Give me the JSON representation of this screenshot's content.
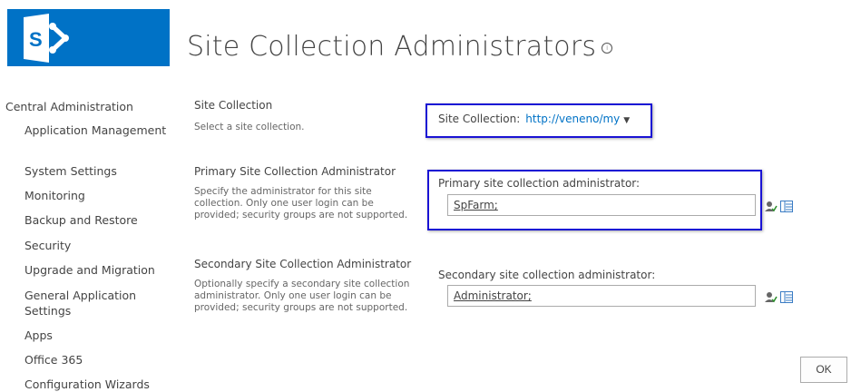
{
  "app": {
    "logo_icon": "sharepoint-logo-icon",
    "brand_color": "#0072c6"
  },
  "page": {
    "title": "Site Collection Administrators",
    "info_glyph": "i"
  },
  "nav": {
    "root": "Central Administration",
    "items": [
      "Application Management",
      "System Settings",
      "Monitoring",
      "Backup and Restore",
      "Security",
      "Upgrade and Migration",
      "General Application Settings",
      "Apps",
      "Office 365",
      "Configuration Wizards"
    ]
  },
  "sections": {
    "site_collection": {
      "title": "Site Collection",
      "description": "Select a site collection.",
      "field_label": "Site Collection:",
      "value": "http://veneno/my"
    },
    "primary": {
      "title": "Primary Site Collection Administrator",
      "description": "Specify the administrator for this site collection. Only one user login can be provided; security groups are not supported.",
      "field_label": "Primary site collection administrator:",
      "value": "SpFarm;"
    },
    "secondary": {
      "title": "Secondary Site Collection Administrator",
      "description": "Optionally specify a secondary site collection administrator. Only one user login can be provided; security groups are not supported.",
      "field_label": "Secondary site collection administrator:",
      "value": "Administrator;"
    }
  },
  "actions": {
    "ok_label": "OK"
  },
  "colors": {
    "highlight": "#1a13d4",
    "link": "#0072c6"
  }
}
